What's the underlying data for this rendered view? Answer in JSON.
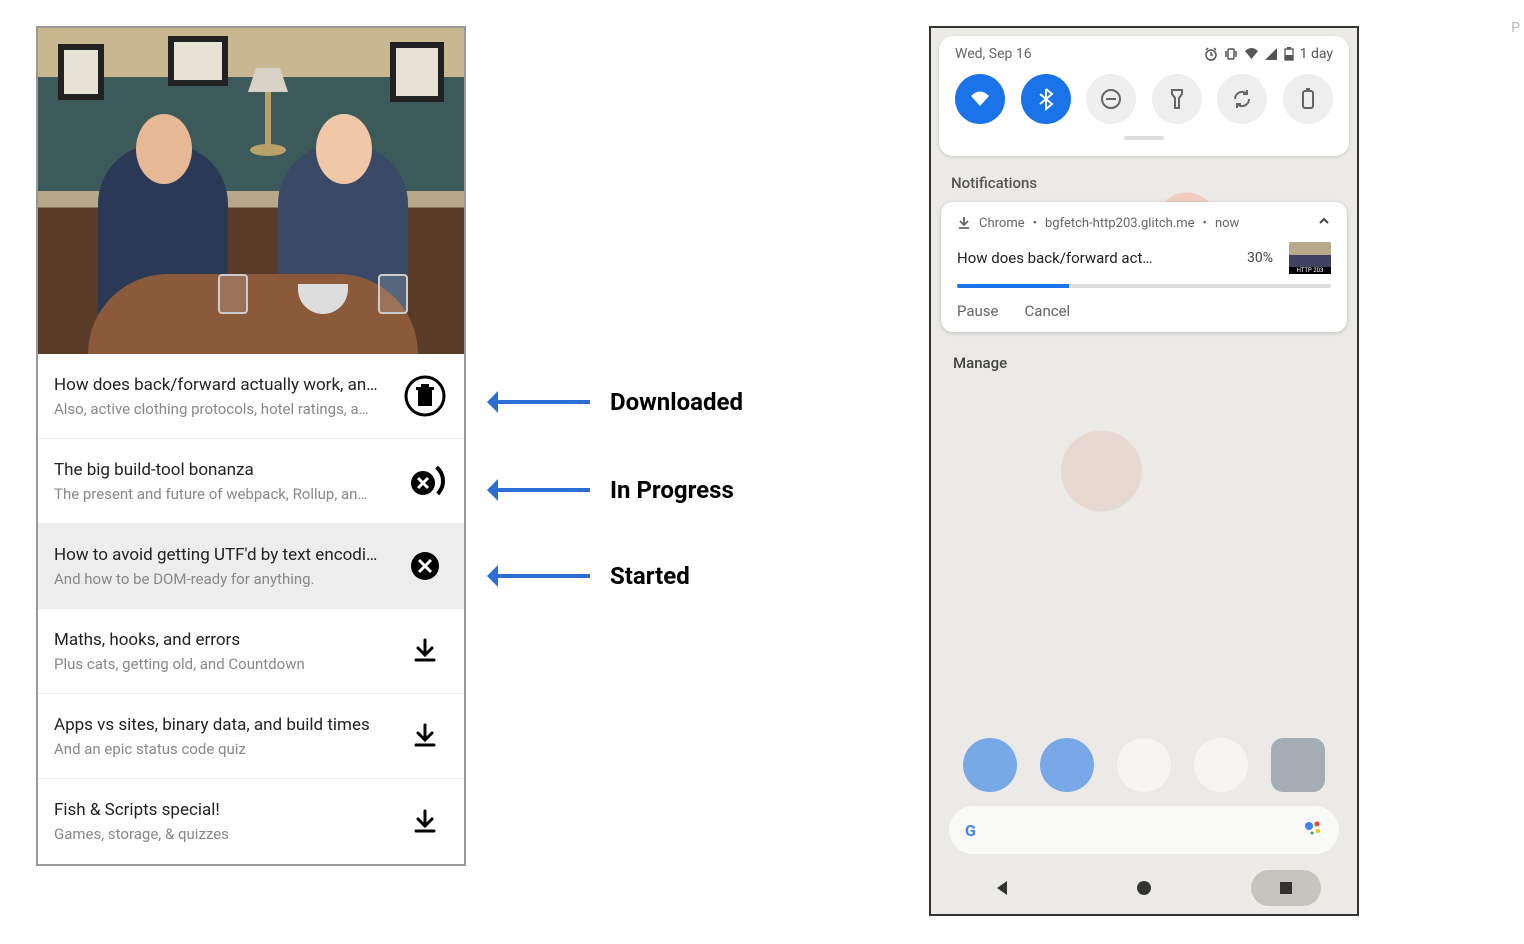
{
  "annotations": {
    "downloaded": "Downloaded",
    "in_progress": "In Progress",
    "started": "Started"
  },
  "left": {
    "episodes": [
      {
        "title": "How does back/forward actually work, an…",
        "sub": "Also, active clothing protocols, hotel ratings, a…",
        "state": "downloaded"
      },
      {
        "title": "The big build-tool bonanza",
        "sub": "The present and future of webpack, Rollup, an…",
        "state": "in_progress"
      },
      {
        "title": "How to avoid getting UTF'd by text encodi…",
        "sub": "And how to be DOM-ready for anything.",
        "state": "started",
        "selected": true
      },
      {
        "title": "Maths, hooks, and errors",
        "sub": "Plus cats, getting old, and Countdown",
        "state": "download"
      },
      {
        "title": "Apps vs sites, binary data, and build times",
        "sub": "And an epic status code quiz",
        "state": "download"
      },
      {
        "title": "Fish & Scripts special!",
        "sub": "Games, storage, & quizzes",
        "state": "download"
      }
    ]
  },
  "right": {
    "status": {
      "date": "Wed, Sep 16",
      "battery_text": "1 day"
    },
    "notif_header": "Notifications",
    "notif": {
      "app": "Chrome",
      "source": "bgfetch-http203.glitch.me",
      "time": "now",
      "title": "How does back/forward act…",
      "percent": "30%",
      "progress_pct": 30,
      "thumb_label": "HTTP 203",
      "actions": {
        "pause": "Pause",
        "cancel": "Cancel"
      }
    },
    "manage": "Manage",
    "search_hint": "G"
  },
  "cropmark": "P"
}
